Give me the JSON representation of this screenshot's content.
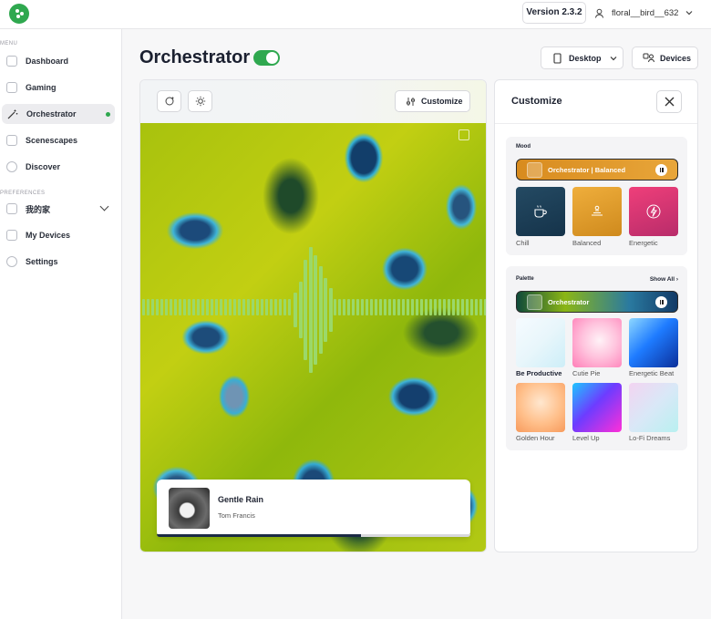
{
  "topbar": {
    "version_label": "Version 2.3.2",
    "username": "floral__bird__632"
  },
  "sidebar": {
    "menu_label": "MENU",
    "preferences_label": "PREFERENCES",
    "menu_items": [
      {
        "label": "Dashboard",
        "icon": "dashboard-icon"
      },
      {
        "label": "Gaming",
        "icon": "gaming-icon"
      },
      {
        "label": "Orchestrator",
        "icon": "magic-wand-icon",
        "active": true
      },
      {
        "label": "Scenescapes",
        "icon": "scenescapes-icon"
      },
      {
        "label": "Discover",
        "icon": "discover-icon"
      }
    ],
    "pref_items": [
      {
        "label": "我的家",
        "icon": "home-icon",
        "expandable": true
      },
      {
        "label": "My Devices",
        "icon": "devices-icon"
      },
      {
        "label": "Settings",
        "icon": "settings-icon"
      }
    ]
  },
  "header": {
    "title": "Orchestrator",
    "toggle_on": true,
    "desktop_label": "Desktop",
    "devices_label": "Devices"
  },
  "visualizer": {
    "customize_label": "Customize",
    "track": {
      "title": "Gentle Rain",
      "artist": "Tom Francis",
      "progress": 0.65
    }
  },
  "customize_panel": {
    "title": "Customize",
    "mood": {
      "label": "Mood",
      "selected": "Orchestrator | Balanced",
      "options": [
        {
          "label": "Chill",
          "icon": "coffee-icon",
          "color": "#1f3f55"
        },
        {
          "label": "Balanced",
          "icon": "balance-icon",
          "color": "#e0a130"
        },
        {
          "label": "Energetic",
          "icon": "lightning-icon",
          "color": "#d23a74"
        }
      ]
    },
    "palette": {
      "label": "Palette",
      "show_all_label": "Show All",
      "selected": "Orchestrator",
      "options": [
        {
          "label": "Be Productive",
          "selected": true
        },
        {
          "label": "Cutie Pie"
        },
        {
          "label": "Energetic Beat"
        },
        {
          "label": "Golden Hour"
        },
        {
          "label": "Level Up"
        },
        {
          "label": "Lo-Fi Dreams"
        }
      ]
    }
  }
}
